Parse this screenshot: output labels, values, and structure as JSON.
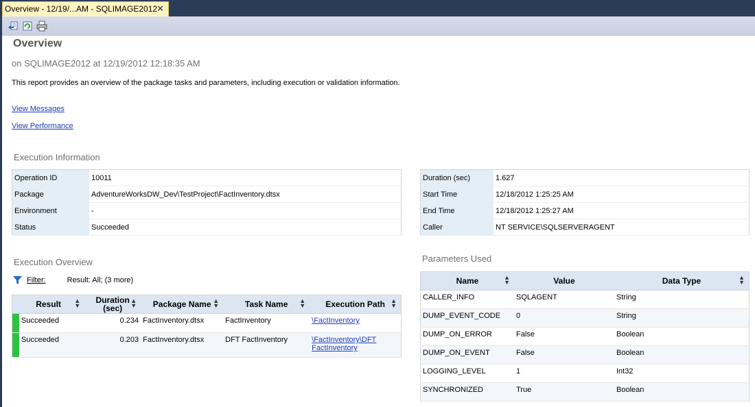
{
  "tab": {
    "title": "Overview - 12/19/...AM - SQLIMAGE2012",
    "close": "✕"
  },
  "toolbar": {
    "buttons": [
      "back-icon",
      "refresh-icon",
      "print-icon"
    ]
  },
  "report": {
    "title": "Overview",
    "subtitle": "on SQLIMAGE2012 at 12/19/2012 12:18:35 AM",
    "description": "This report provides an overview of the package tasks and parameters, including execution or validation information.",
    "link_messages": "View Messages",
    "link_performance": "View Performance"
  },
  "execution_info": {
    "heading": "Execution Information",
    "left": [
      {
        "key": "Operation ID",
        "value": "10011"
      },
      {
        "key": "Package",
        "value": "AdventureWorksDW_Dev\\TestProject\\FactInventory.dtsx"
      },
      {
        "key": "Environment",
        "value": "-"
      },
      {
        "key": "Status",
        "value": "Succeeded"
      }
    ],
    "right": [
      {
        "key": "Duration (sec)",
        "value": "1.627"
      },
      {
        "key": "Start Time",
        "value": "12/18/2012 1:25:25 AM"
      },
      {
        "key": "End Time",
        "value": "12/18/2012 1:25:27 AM"
      },
      {
        "key": "Caller",
        "value": "NT SERVICE\\SQLSERVERAGENT"
      }
    ]
  },
  "execution_overview": {
    "heading": "Execution Overview",
    "filter_label": "Filter:",
    "filter_text": "Result: All;  (3 more)",
    "columns": [
      "Result",
      "Duration (sec)",
      "Package Name",
      "Task Name",
      "Execution Path"
    ],
    "rows": [
      {
        "result": "Succeeded",
        "duration": "0.234",
        "package": "FactInventory.dtsx",
        "task": "FactInventory",
        "path": "\\FactInventory",
        "status_color": "#2ec240"
      },
      {
        "result": "Succeeded",
        "duration": "0.203",
        "package": "FactInventory.dtsx",
        "task": "DFT FactInventory",
        "path": "\\FactInventory\\DFT FactInventory",
        "status_color": "#2ec240"
      }
    ]
  },
  "parameters": {
    "heading": "Parameters Used",
    "columns": [
      "Name",
      "Value",
      "Data Type"
    ],
    "rows": [
      {
        "name": "CALLER_INFO",
        "value": "SQLAGENT",
        "type": "String"
      },
      {
        "name": "DUMP_EVENT_CODE",
        "value": "0",
        "type": "String"
      },
      {
        "name": "DUMP_ON_ERROR",
        "value": "False",
        "type": "Boolean"
      },
      {
        "name": "DUMP_ON_EVENT",
        "value": "False",
        "type": "Boolean"
      },
      {
        "name": "LOGGING_LEVEL",
        "value": "1",
        "type": "Int32"
      },
      {
        "name": "SYNCHRONIZED",
        "value": "True",
        "type": "Boolean"
      }
    ]
  },
  "colors": {
    "accent": "#1a3cbd",
    "success": "#2ec240",
    "header_bg": "#dce6f2",
    "frame": "#2b3c59"
  }
}
